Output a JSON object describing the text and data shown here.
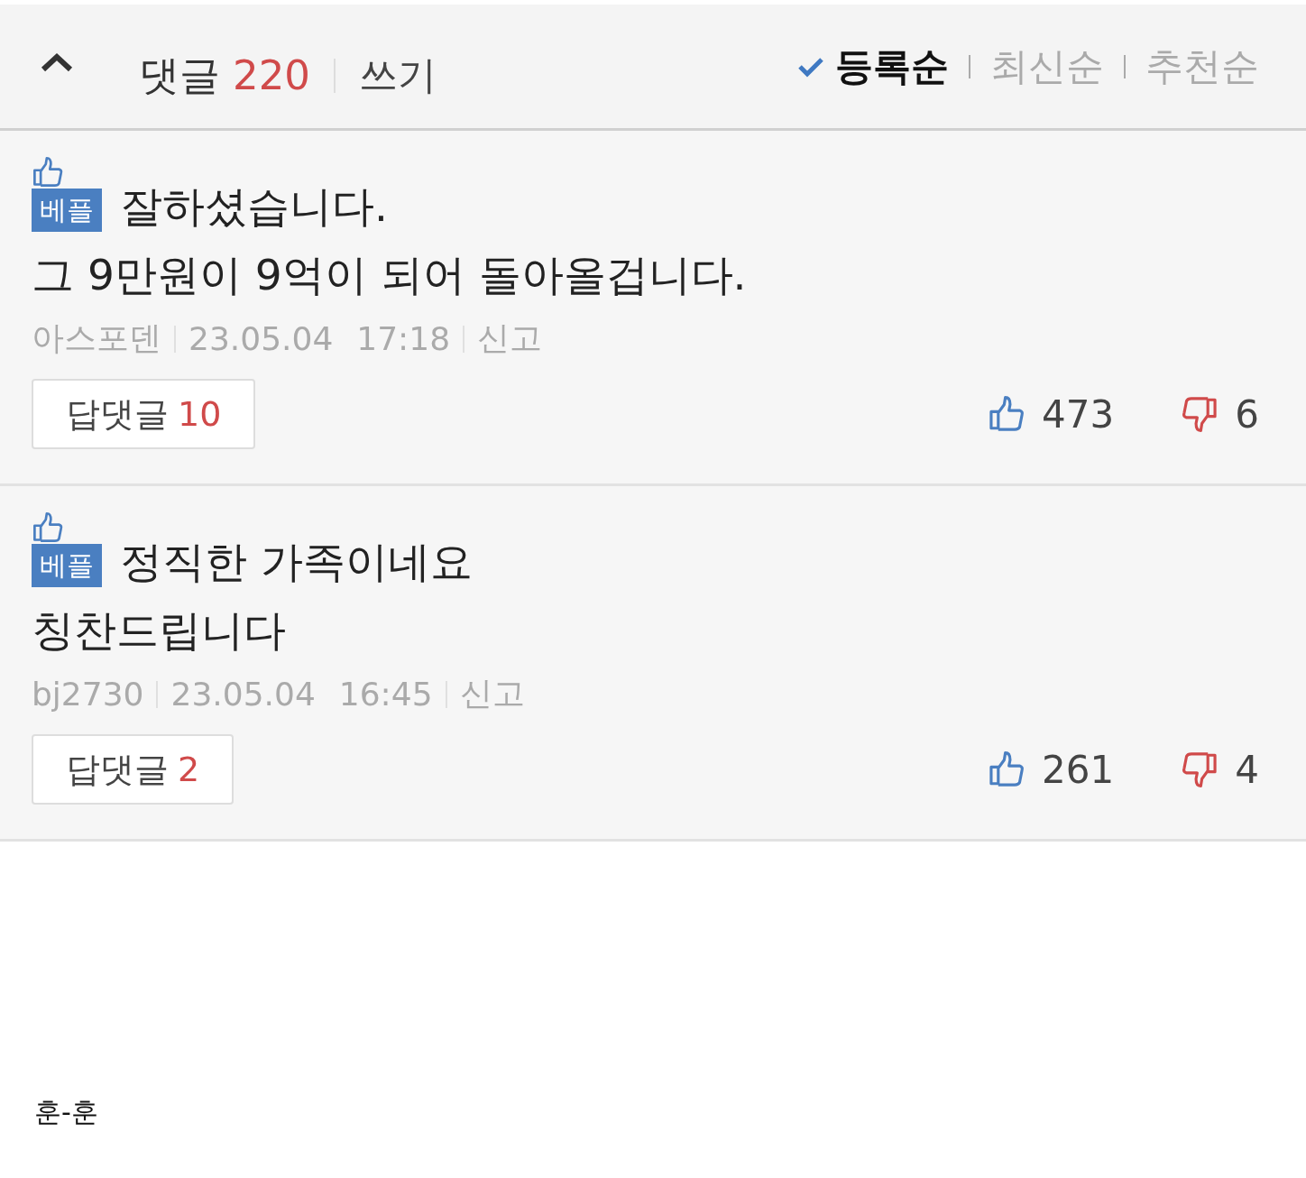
{
  "header": {
    "title": "댓글",
    "count": "220",
    "write": "쓰기",
    "sort_options": [
      {
        "label": "등록순",
        "selected": true
      },
      {
        "label": "최신순",
        "selected": false
      },
      {
        "label": "추천순",
        "selected": false
      }
    ]
  },
  "comments": [
    {
      "best": true,
      "badge": "베플",
      "lines": [
        "잘하셨습니다.",
        "그 9만원이 9억이 되어 돌아올겁니다."
      ],
      "author": "아스포덴",
      "date": "23.05.04",
      "time": "17:18",
      "report": "신고",
      "reply_label": "답댓글",
      "reply_count": "10",
      "likes": "473",
      "dislikes": "6"
    },
    {
      "best": true,
      "badge": "베플",
      "lines": [
        "정직한 가족이네요",
        "칭찬드립니다"
      ],
      "author": "bj2730",
      "date": "23.05.04",
      "time": "16:45",
      "report": "신고",
      "reply_label": "답댓글",
      "reply_count": "2",
      "likes": "261",
      "dislikes": "4"
    }
  ],
  "caption": "훈-훈"
}
